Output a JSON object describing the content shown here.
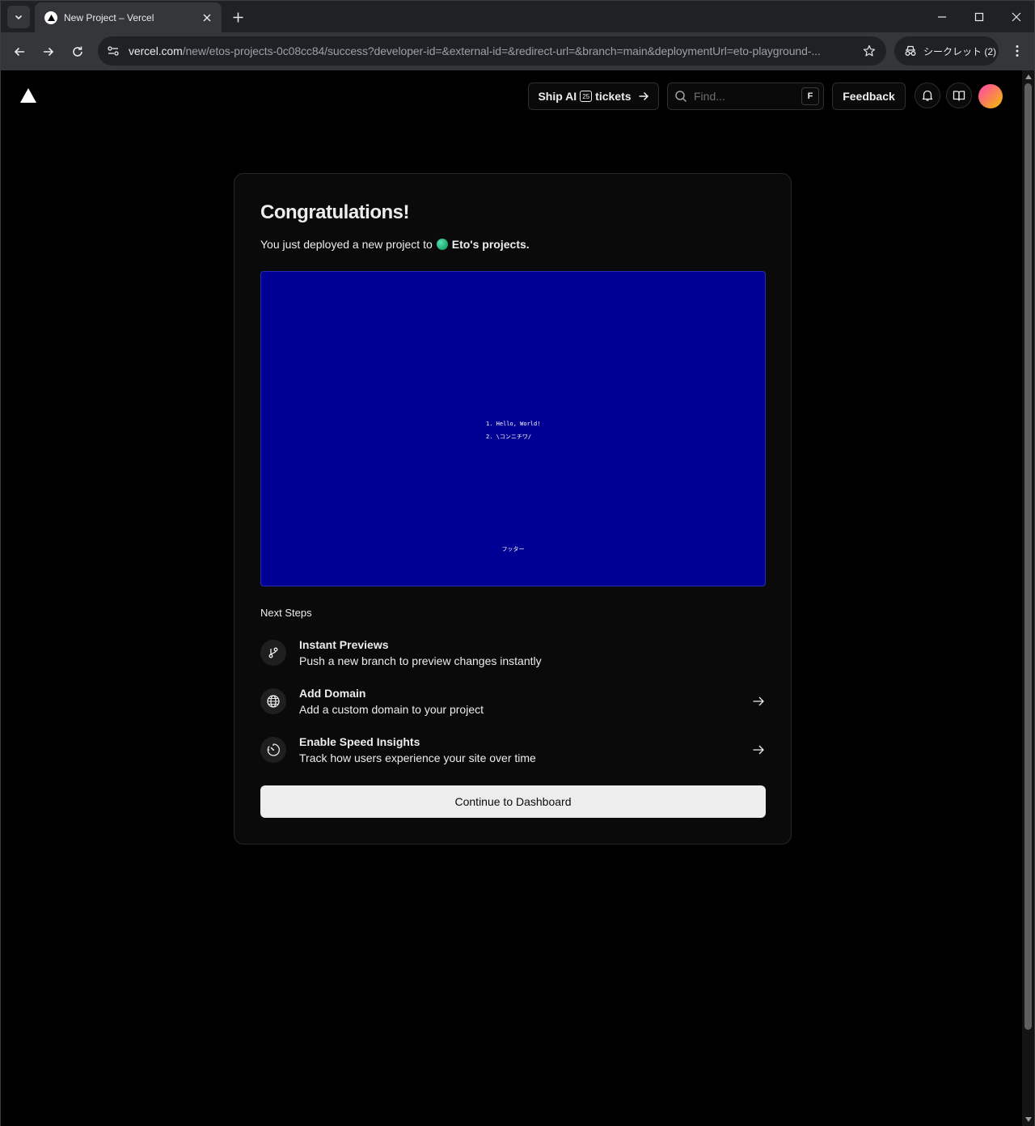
{
  "browser": {
    "tab_title": "New Project – Vercel",
    "url_host": "vercel.com",
    "url_path": "/new/etos-projects-0c08cc84/success?developer-id=&external-id=&redirect-url=&branch=main&deploymentUrl=eto-playground-...",
    "incognito_label": "シークレット (2)"
  },
  "header": {
    "ship_label_prefix": "Ship AI",
    "ship_badge": "25",
    "ship_label_suffix": "tickets",
    "search_placeholder": "Find...",
    "search_shortcut": "F",
    "feedback_label": "Feedback"
  },
  "card": {
    "title": "Congratulations!",
    "subtitle_prefix": "You just deployed a new project to",
    "team_name": "Eto's projects.",
    "preview": {
      "list_items": [
        "1. Hello, World!",
        "2. \\コンニチワ/"
      ],
      "footer": "フッター",
      "background": "#000094"
    },
    "next_steps_title": "Next Steps",
    "steps": [
      {
        "title": "Instant Previews",
        "description": "Push a new branch to preview changes instantly",
        "icon": "git-branch-icon",
        "has_arrow": false
      },
      {
        "title": "Add Domain",
        "description": "Add a custom domain to your project",
        "icon": "globe-icon",
        "has_arrow": true
      },
      {
        "title": "Enable Speed Insights",
        "description": "Track how users experience your site over time",
        "icon": "speed-gauge-icon",
        "has_arrow": true
      }
    ],
    "continue_label": "Continue to Dashboard"
  }
}
